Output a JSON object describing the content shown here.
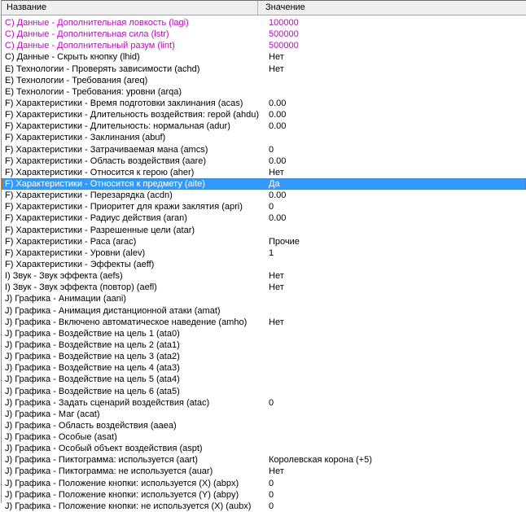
{
  "table": {
    "columns": {
      "name_label": "Название",
      "value_label": "Значение"
    },
    "colors": {
      "modified_value_text": "#cc00cc",
      "selection_background": "#3399ff",
      "selection_text": "#ffffff",
      "selection_focus_dotted": "#c05f00",
      "header_background": "#efefef",
      "header_border": "#a3a3a3",
      "panel_border": "#8c8c8c"
    },
    "rows": [
      {
        "name": "C) Данные - Дополнительная ловкость (lagi)",
        "value": "100000",
        "style": "magenta",
        "selected": false
      },
      {
        "name": "C) Данные - Дополнительная сила (lstr)",
        "value": "500000",
        "style": "magenta",
        "selected": false
      },
      {
        "name": "C) Данные - Дополнительный разум (lint)",
        "value": "500000",
        "style": "magenta",
        "selected": false
      },
      {
        "name": "C) Данные - Скрыть кнопку (lhid)",
        "value": "Нет",
        "style": "normal",
        "selected": false
      },
      {
        "name": "E) Технологии - Проверять зависимости (achd)",
        "value": "Нет",
        "style": "normal",
        "selected": false
      },
      {
        "name": "E) Технологии - Требования (areq)",
        "value": "",
        "style": "normal",
        "selected": false
      },
      {
        "name": "E) Технологии - Требования: уровни (arqa)",
        "value": "",
        "style": "normal",
        "selected": false
      },
      {
        "name": "F) Характеристики - Время подготовки заклинания (acas)",
        "value": "0.00",
        "style": "normal",
        "selected": false
      },
      {
        "name": "F) Характеристики - Длительность воздействия: герой (ahdu)",
        "value": "0.00",
        "style": "normal",
        "selected": false
      },
      {
        "name": "F) Характеристики - Длительность: нормальная (adur)",
        "value": "0.00",
        "style": "normal",
        "selected": false
      },
      {
        "name": "F) Характеристики - Заклинания (abuf)",
        "value": "",
        "style": "normal",
        "selected": false
      },
      {
        "name": "F) Характеристики - Затрачиваемая мана (amcs)",
        "value": "0",
        "style": "normal",
        "selected": false
      },
      {
        "name": "F) Характеристики - Область воздействия (aare)",
        "value": "0.00",
        "style": "normal",
        "selected": false
      },
      {
        "name": "F) Характеристики - Относится к герою (aher)",
        "value": "Нет",
        "style": "normal",
        "selected": false
      },
      {
        "name": "F) Характеристики - Относится к предмету (aite)",
        "value": "Да",
        "style": "normal",
        "selected": true
      },
      {
        "name": "F) Характеристики - Перезарядка (acdn)",
        "value": "0.00",
        "style": "normal",
        "selected": false
      },
      {
        "name": "F) Характеристики - Приоритет для кражи заклятия (apri)",
        "value": "0",
        "style": "normal",
        "selected": false
      },
      {
        "name": "F) Характеристики - Радиус действия (aran)",
        "value": "0.00",
        "style": "normal",
        "selected": false
      },
      {
        "name": "F) Характеристики - Разрешенные цели (atar)",
        "value": "",
        "style": "normal",
        "selected": false
      },
      {
        "name": "F) Характеристики - Раса (arac)",
        "value": "Прочие",
        "style": "normal",
        "selected": false
      },
      {
        "name": "F) Характеристики - Уровни (alev)",
        "value": "1",
        "style": "normal",
        "selected": false
      },
      {
        "name": "F) Характеристики - Эффекты (aeff)",
        "value": "",
        "style": "normal",
        "selected": false
      },
      {
        "name": "I) Звук - Звук эффекта (aefs)",
        "value": "Нет",
        "style": "normal",
        "selected": false
      },
      {
        "name": "I) Звук - Звук эффекта (повтор) (aefl)",
        "value": "Нет",
        "style": "normal",
        "selected": false
      },
      {
        "name": "J) Графика - Анимации (aani)",
        "value": "",
        "style": "normal",
        "selected": false
      },
      {
        "name": "J) Графика - Анимация дистанционной атаки (amat)",
        "value": "",
        "style": "normal",
        "selected": false
      },
      {
        "name": "J) Графика - Включено автоматическое наведение (amho)",
        "value": "Нет",
        "style": "normal",
        "selected": false
      },
      {
        "name": "J) Графика - Воздействие на цель 1 (ata0)",
        "value": "",
        "style": "normal",
        "selected": false
      },
      {
        "name": "J) Графика - Воздействие на цель 2 (ata1)",
        "value": "",
        "style": "normal",
        "selected": false
      },
      {
        "name": "J) Графика - Воздействие на цель 3 (ata2)",
        "value": "",
        "style": "normal",
        "selected": false
      },
      {
        "name": "J) Графика - Воздействие на цель 4 (ata3)",
        "value": "",
        "style": "normal",
        "selected": false
      },
      {
        "name": "J) Графика - Воздействие на цель 5 (ata4)",
        "value": "",
        "style": "normal",
        "selected": false
      },
      {
        "name": "J) Графика - Воздействие на цель 6 (ata5)",
        "value": "",
        "style": "normal",
        "selected": false
      },
      {
        "name": "J) Графика - Задать сценарий воздействия (atac)",
        "value": "0",
        "style": "normal",
        "selected": false
      },
      {
        "name": "J) Графика - Маг (acat)",
        "value": "",
        "style": "normal",
        "selected": false
      },
      {
        "name": "J) Графика - Область воздействия (aaea)",
        "value": "",
        "style": "normal",
        "selected": false
      },
      {
        "name": "J) Графика - Особые (asat)",
        "value": "",
        "style": "normal",
        "selected": false
      },
      {
        "name": "J) Графика - Особый объект воздействия (aspt)",
        "value": "",
        "style": "normal",
        "selected": false
      },
      {
        "name": "J) Графика - Пиктограмма: используется (aart)",
        "value": "Королевская корона (+5)",
        "style": "normal",
        "selected": false
      },
      {
        "name": "J) Графика - Пиктограмма: не используется (auar)",
        "value": "Нет",
        "style": "normal",
        "selected": false
      },
      {
        "name": "J) Графика - Положение кнопки: используется (X) (abpx)",
        "value": "0",
        "style": "normal",
        "selected": false
      },
      {
        "name": "J) Графика - Положение кнопки: используется (Y) (abpy)",
        "value": "0",
        "style": "normal",
        "selected": false
      },
      {
        "name": "J) Графика - Положение кнопки: не используется (X) (aubx)",
        "value": "0",
        "style": "normal",
        "selected": false
      }
    ]
  }
}
